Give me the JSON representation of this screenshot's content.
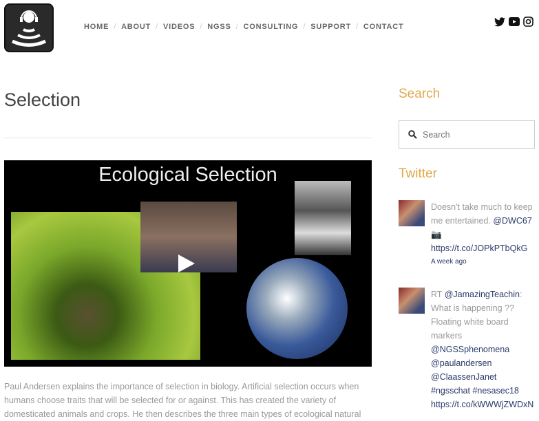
{
  "nav": {
    "items": [
      "HOME",
      "ABOUT",
      "VIDEOS",
      "NGSS",
      "CONSULTING",
      "SUPPORT",
      "CONTACT"
    ]
  },
  "social": [
    "twitter-icon",
    "youtube-icon",
    "instagram-icon"
  ],
  "page": {
    "title": "Selection",
    "video_title": "Ecological Selection",
    "description": "Paul Andersen explains the importance of selection in biology. Artificial selection occurs when humans choose traits that will be selected for or against. This has created the variety of domesticated animals and crops. He then describes the three main types of ecological natural"
  },
  "sidebar": {
    "search_heading": "Search",
    "search_placeholder": "Search",
    "twitter_heading": "Twitter",
    "tweets": [
      {
        "text1": "Doesn't take much to keep me entertained. ",
        "mention": "@DWC67",
        "link": "https://t.co/JOPkPTbQkG",
        "time": "A week ago"
      },
      {
        "rt": "RT ",
        "mention": "@JamazingTeachin",
        "text1": ": What is happening ?? Floating white board markers",
        "m2": "@NGSSphenomena",
        "m3": "@paulandersen",
        "m4": "@ClaassenJanet",
        "tags": " #ngsschat #nesasec18",
        "link": "https://t.co/kWWWjZWDxN"
      }
    ]
  }
}
